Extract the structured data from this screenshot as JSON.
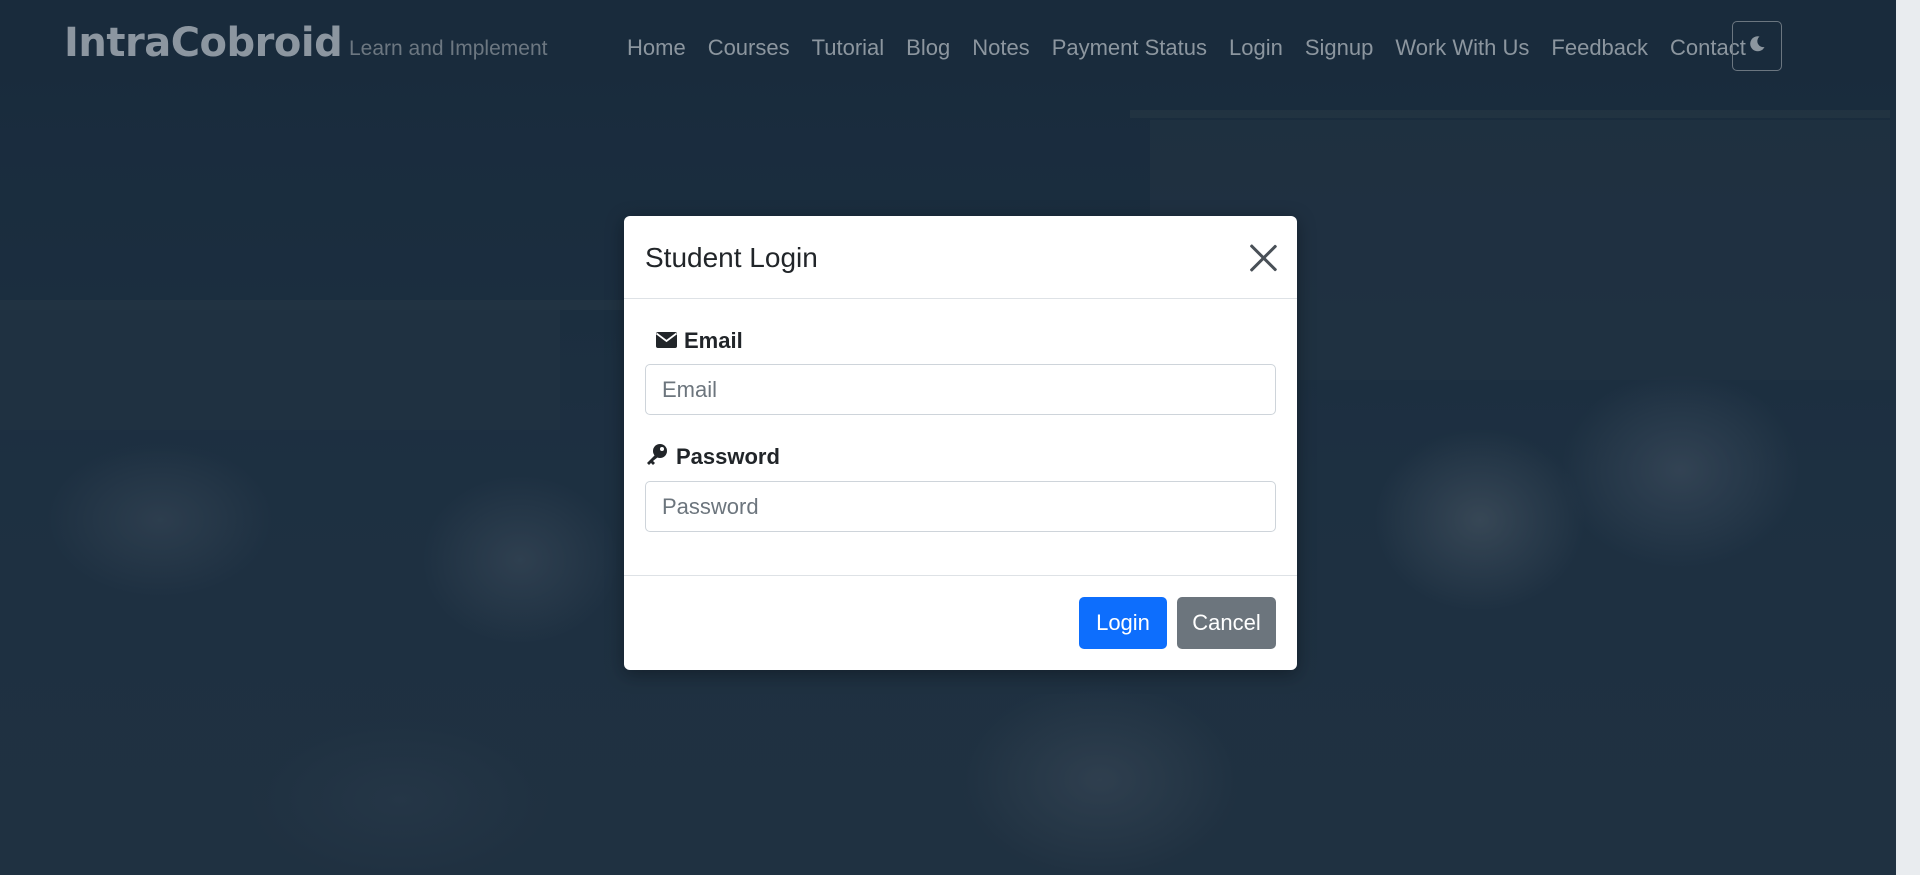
{
  "navbar": {
    "brand": "IntraCobroid",
    "tagline": "Learn and Implement",
    "links": [
      {
        "label": "Home"
      },
      {
        "label": "Courses"
      },
      {
        "label": "Tutorial"
      },
      {
        "label": "Blog"
      },
      {
        "label": "Notes"
      },
      {
        "label": "Payment Status"
      },
      {
        "label": "Login"
      },
      {
        "label": "Signup"
      },
      {
        "label": "Work With Us"
      },
      {
        "label": "Feedback"
      },
      {
        "label": "Contact"
      }
    ],
    "theme_toggle_icon": "moon-icon"
  },
  "modal": {
    "title": "Student Login",
    "close_icon": "close-icon",
    "email": {
      "label": "Email",
      "icon": "envelope-icon",
      "placeholder": "Email",
      "value": ""
    },
    "password": {
      "label": "Password",
      "icon": "key-icon",
      "placeholder": "Password",
      "value": ""
    },
    "buttons": {
      "login": "Login",
      "cancel": "Cancel"
    }
  },
  "colors": {
    "primary": "#0d6efd",
    "secondary": "#6c757d",
    "backdrop": "#1f3448"
  }
}
